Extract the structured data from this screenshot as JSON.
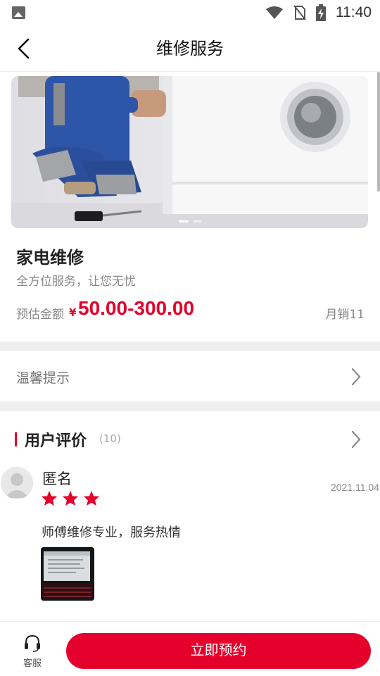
{
  "status_bar": {
    "time": "11:40",
    "icons": [
      "image-icon",
      "wifi-icon",
      "no-sim-icon",
      "battery-charging-icon"
    ]
  },
  "header": {
    "title": "维修服务",
    "back_icon": "chevron-left-icon"
  },
  "banner": {
    "image": "washing-machine-repair-photo",
    "slide_count": 2,
    "active_slide": 1
  },
  "product": {
    "name": "家电维修",
    "subtitle": "全方位服务，让您无忧",
    "price_label": "预估金额",
    "currency": "¥",
    "price": "50.00-300.00",
    "sales": "月销11"
  },
  "tips": {
    "label": "温馨提示"
  },
  "reviews": {
    "title": "用户评价",
    "count": "(10)",
    "items": [
      {
        "user": "匿名",
        "rating": 3,
        "date": "2021.11.04",
        "text": "师傅维修专业，服务热情",
        "photo": "repair-photo-thumbnail"
      }
    ]
  },
  "bottom_bar": {
    "service_label": "客服",
    "service_icon": "headset-icon",
    "book_label": "立即预约"
  },
  "colors": {
    "accent": "#e4002b",
    "divider": "#efefef",
    "muted_text": "#888888"
  }
}
